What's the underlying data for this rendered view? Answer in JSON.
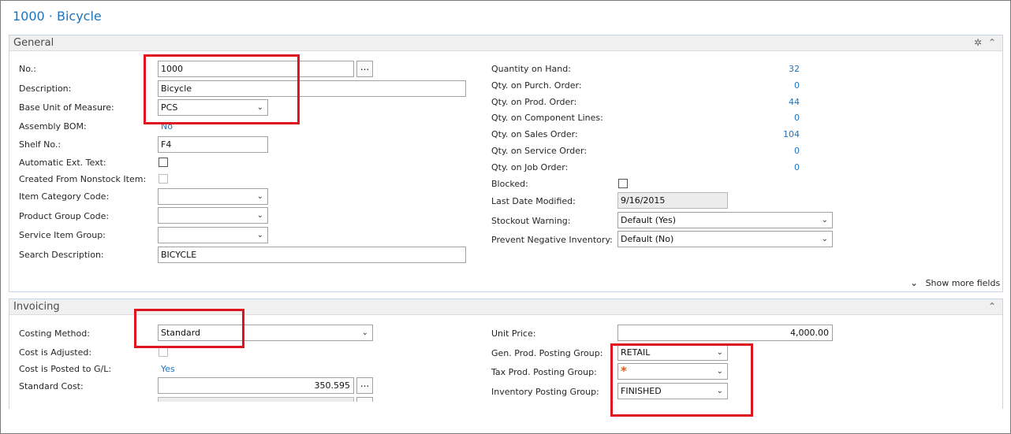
{
  "page_title": "1000 · Bicycle",
  "general": {
    "title": "General",
    "left": {
      "no_label": "No.:",
      "no_value": "1000",
      "description_label": "Description:",
      "description_value": "Bicycle",
      "base_uom_label": "Base Unit of Measure:",
      "base_uom_value": "PCS",
      "assembly_bom_label": "Assembly BOM:",
      "assembly_bom_value": "No",
      "shelf_no_label": "Shelf No.:",
      "shelf_no_value": "F4",
      "auto_ext_text_label": "Automatic Ext. Text:",
      "created_from_nonstock_label": "Created From Nonstock Item:",
      "item_category_label": "Item Category Code:",
      "item_category_value": "",
      "product_group_label": "Product Group Code:",
      "product_group_value": "",
      "service_item_group_label": "Service Item Group:",
      "service_item_group_value": "",
      "search_description_label": "Search Description:",
      "search_description_value": "BICYCLE"
    },
    "right": {
      "qty_on_hand_label": "Quantity on Hand:",
      "qty_on_hand_value": "32",
      "qty_purch_label": "Qty. on Purch. Order:",
      "qty_purch_value": "0",
      "qty_prod_label": "Qty. on Prod. Order:",
      "qty_prod_value": "44",
      "qty_component_label": "Qty. on Component Lines:",
      "qty_component_value": "0",
      "qty_sales_label": "Qty. on Sales Order:",
      "qty_sales_value": "104",
      "qty_service_label": "Qty. on Service Order:",
      "qty_service_value": "0",
      "qty_job_label": "Qty. on Job Order:",
      "qty_job_value": "0",
      "blocked_label": "Blocked:",
      "last_modified_label": "Last Date Modified:",
      "last_modified_value": "9/16/2015",
      "stockout_label": "Stockout Warning:",
      "stockout_value": "Default (Yes)",
      "prevent_negative_label": "Prevent Negative Inventory:",
      "prevent_negative_value": "Default (No)"
    },
    "show_more": "Show more fields"
  },
  "invoicing": {
    "title": "Invoicing",
    "left": {
      "costing_method_label": "Costing Method:",
      "costing_method_value": "Standard",
      "cost_adjusted_label": "Cost is Adjusted:",
      "cost_posted_label": "Cost is Posted to G/L:",
      "cost_posted_value": "Yes",
      "standard_cost_label": "Standard Cost:",
      "standard_cost_value": "350.595"
    },
    "right": {
      "unit_price_label": "Unit Price:",
      "unit_price_value": "4,000.00",
      "gen_prod_label": "Gen. Prod. Posting Group:",
      "gen_prod_value": "RETAIL",
      "tax_prod_label": "Tax Prod. Posting Group:",
      "tax_prod_value": "*",
      "inventory_posting_label": "Inventory Posting Group:",
      "inventory_posting_value": "FINISHED"
    }
  },
  "icons": {
    "dots": "...",
    "chevron": "⌄",
    "collapse": "⌃",
    "settings": "✲"
  },
  "colors": {
    "accent": "#1e73be",
    "highlight": "#e0141e"
  }
}
